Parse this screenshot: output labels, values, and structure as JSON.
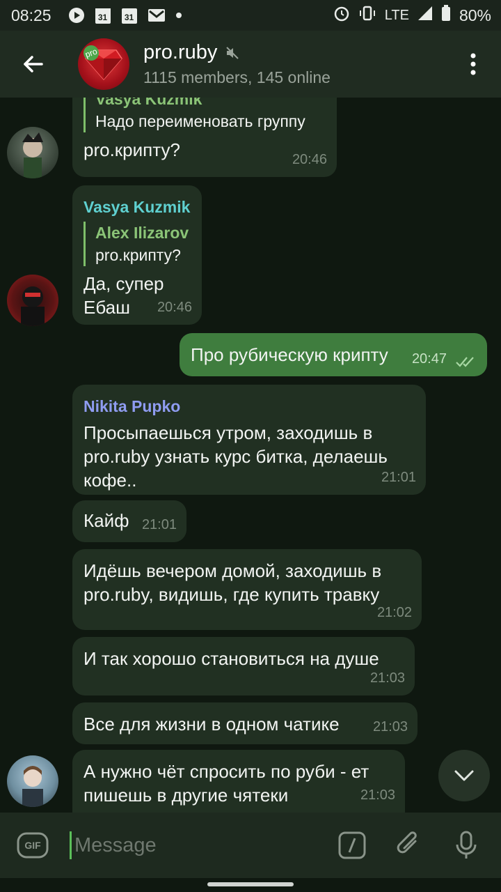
{
  "status_bar": {
    "time": "08:25",
    "calendar_day_1": "31",
    "calendar_day_2": "31",
    "network": "LTE",
    "battery": "80%"
  },
  "header": {
    "title": "pro.ruby",
    "subtitle": "1115 members, 145 online",
    "avatar_badge": "pro"
  },
  "messages": [
    {
      "reply_name": "Vasya Kuzmik",
      "reply_text": "Надо переименовать группу",
      "text": "pro.крипту?",
      "time": "20:46"
    },
    {
      "sender": "Vasya Kuzmik",
      "sender_color": "#5fd0d0",
      "reply_name": "Alex Ilizarov",
      "reply_text": "pro.крипту?",
      "text_line1": "Да, супер",
      "text_line2": "Ебаш",
      "time": "20:46"
    },
    {
      "text": "Про рубическую крипту",
      "time": "20:47",
      "outgoing": true
    },
    {
      "sender": "Nikita Pupko",
      "sender_color": "#8f9cf0",
      "text": "Просыпаешься утром, заходишь в pro.ruby узнать курс битка, делаешь кофе..",
      "time": "21:01"
    },
    {
      "text": "Кайф",
      "time": "21:01"
    },
    {
      "text": "Идёшь вечером домой, заходишь в pro.ruby, видишь, где купить травку",
      "time": "21:02"
    },
    {
      "text": "И так хорошо становиться на душе",
      "time": "21:03"
    },
    {
      "text": "Все для жизни в одном чатике",
      "time": "21:03"
    },
    {
      "text": "А нужно чёт спросить по руби - ет пишешь в другие чятеки",
      "time": "21:03"
    }
  ],
  "input": {
    "gif_label": "GIF",
    "placeholder": "Message"
  },
  "colors": {
    "background": "#0f1810",
    "bubble_in": "#213022",
    "bubble_out": "#3f7d3e",
    "accent": "#5bbf5a"
  }
}
